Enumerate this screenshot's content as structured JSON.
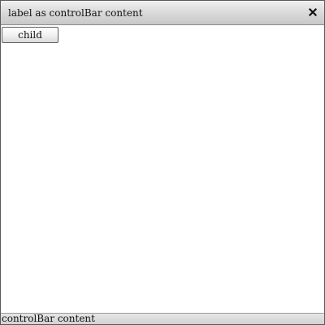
{
  "window": {
    "title": "label as controlBar content",
    "close_icon": "close-icon"
  },
  "content": {
    "child_button_label": "child"
  },
  "control_bar": {
    "text": "controlBar content"
  },
  "colors": {
    "border": "#5a5a5a",
    "titlebar_top": "#f1f1f1",
    "titlebar_bottom": "#c8c8c8",
    "background": "#ffffff"
  }
}
